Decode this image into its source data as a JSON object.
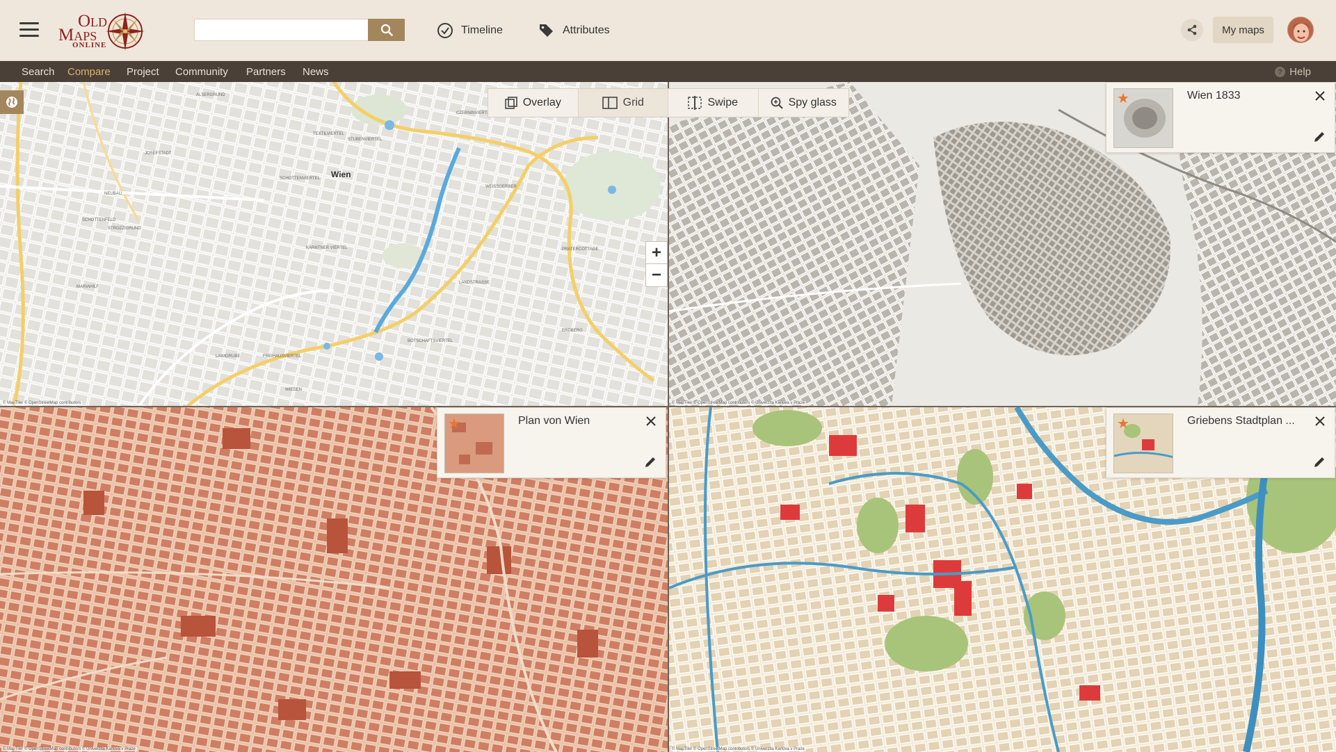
{
  "header": {
    "logo": {
      "line1": "Old",
      "line2": "Maps",
      "line3": "ONLINE"
    },
    "search": {
      "value": "",
      "placeholder": ""
    },
    "timeline_label": "Timeline",
    "attributes_label": "Attributes",
    "mymaps_label": "My maps"
  },
  "nav": {
    "items": [
      {
        "label": "Search"
      },
      {
        "label": "Compare"
      },
      {
        "label": "Project"
      },
      {
        "label": "Community"
      },
      {
        "label": "Partners"
      },
      {
        "label": "News"
      }
    ],
    "active": "Compare",
    "help_label": "Help"
  },
  "compare": {
    "modes": [
      {
        "label": "Overlay",
        "icon": "overlay-icon"
      },
      {
        "label": "Grid",
        "icon": "grid-icon"
      },
      {
        "label": "Swipe",
        "icon": "swipe-icon"
      },
      {
        "label": "Spy glass",
        "icon": "spyglass-icon"
      }
    ],
    "active_mode": "Grid"
  },
  "basemap": {
    "city_label": "Wien",
    "attribution": "© MapTiler © OpenStreetMap contributors",
    "district_labels": [
      "SCHOTTENFELD",
      "NEUBAU",
      "JOSEFSTADT",
      "ALSERGRUND",
      "LANDSTRASSE",
      "WIEDEN",
      "MARIAHILF",
      "STROZZIGRUND",
      "LAIMGRUBE",
      "FREIHAUSVIERTEL",
      "SCHOTTENVIERTEL",
      "STUBENVIERTEL",
      "PRATERCOTTAGE",
      "ERDBERG",
      "BOTSCHAFTSVIERTEL",
      "KÄRNTNER VIERTEL",
      "WEISSGERBER",
      "CZERNINVIERTEL",
      "TEXTILVIERTEL"
    ]
  },
  "maps": [
    {
      "title": "Wien 1833",
      "attribution": "© MapTiler © OpenStreetMap contributors © Univerzita Karlova v Praze"
    },
    {
      "title": "Plan von Wien",
      "attribution": "© MapTiler © OpenStreetMap contributors © Univerzita Karlova v Praze"
    },
    {
      "title": "Griebens Stadtplan ...",
      "attribution": "© MapTiler © OpenStreetMap contributors © Univerzita Karlova v Praze"
    }
  ],
  "colors": {
    "header_bg": "#efe7dc",
    "navbar_bg": "#4b4037",
    "nav_active": "#d9b26e",
    "accent_button": "#a3865c",
    "star": "#e8772e",
    "logo_red": "#8e2121"
  }
}
